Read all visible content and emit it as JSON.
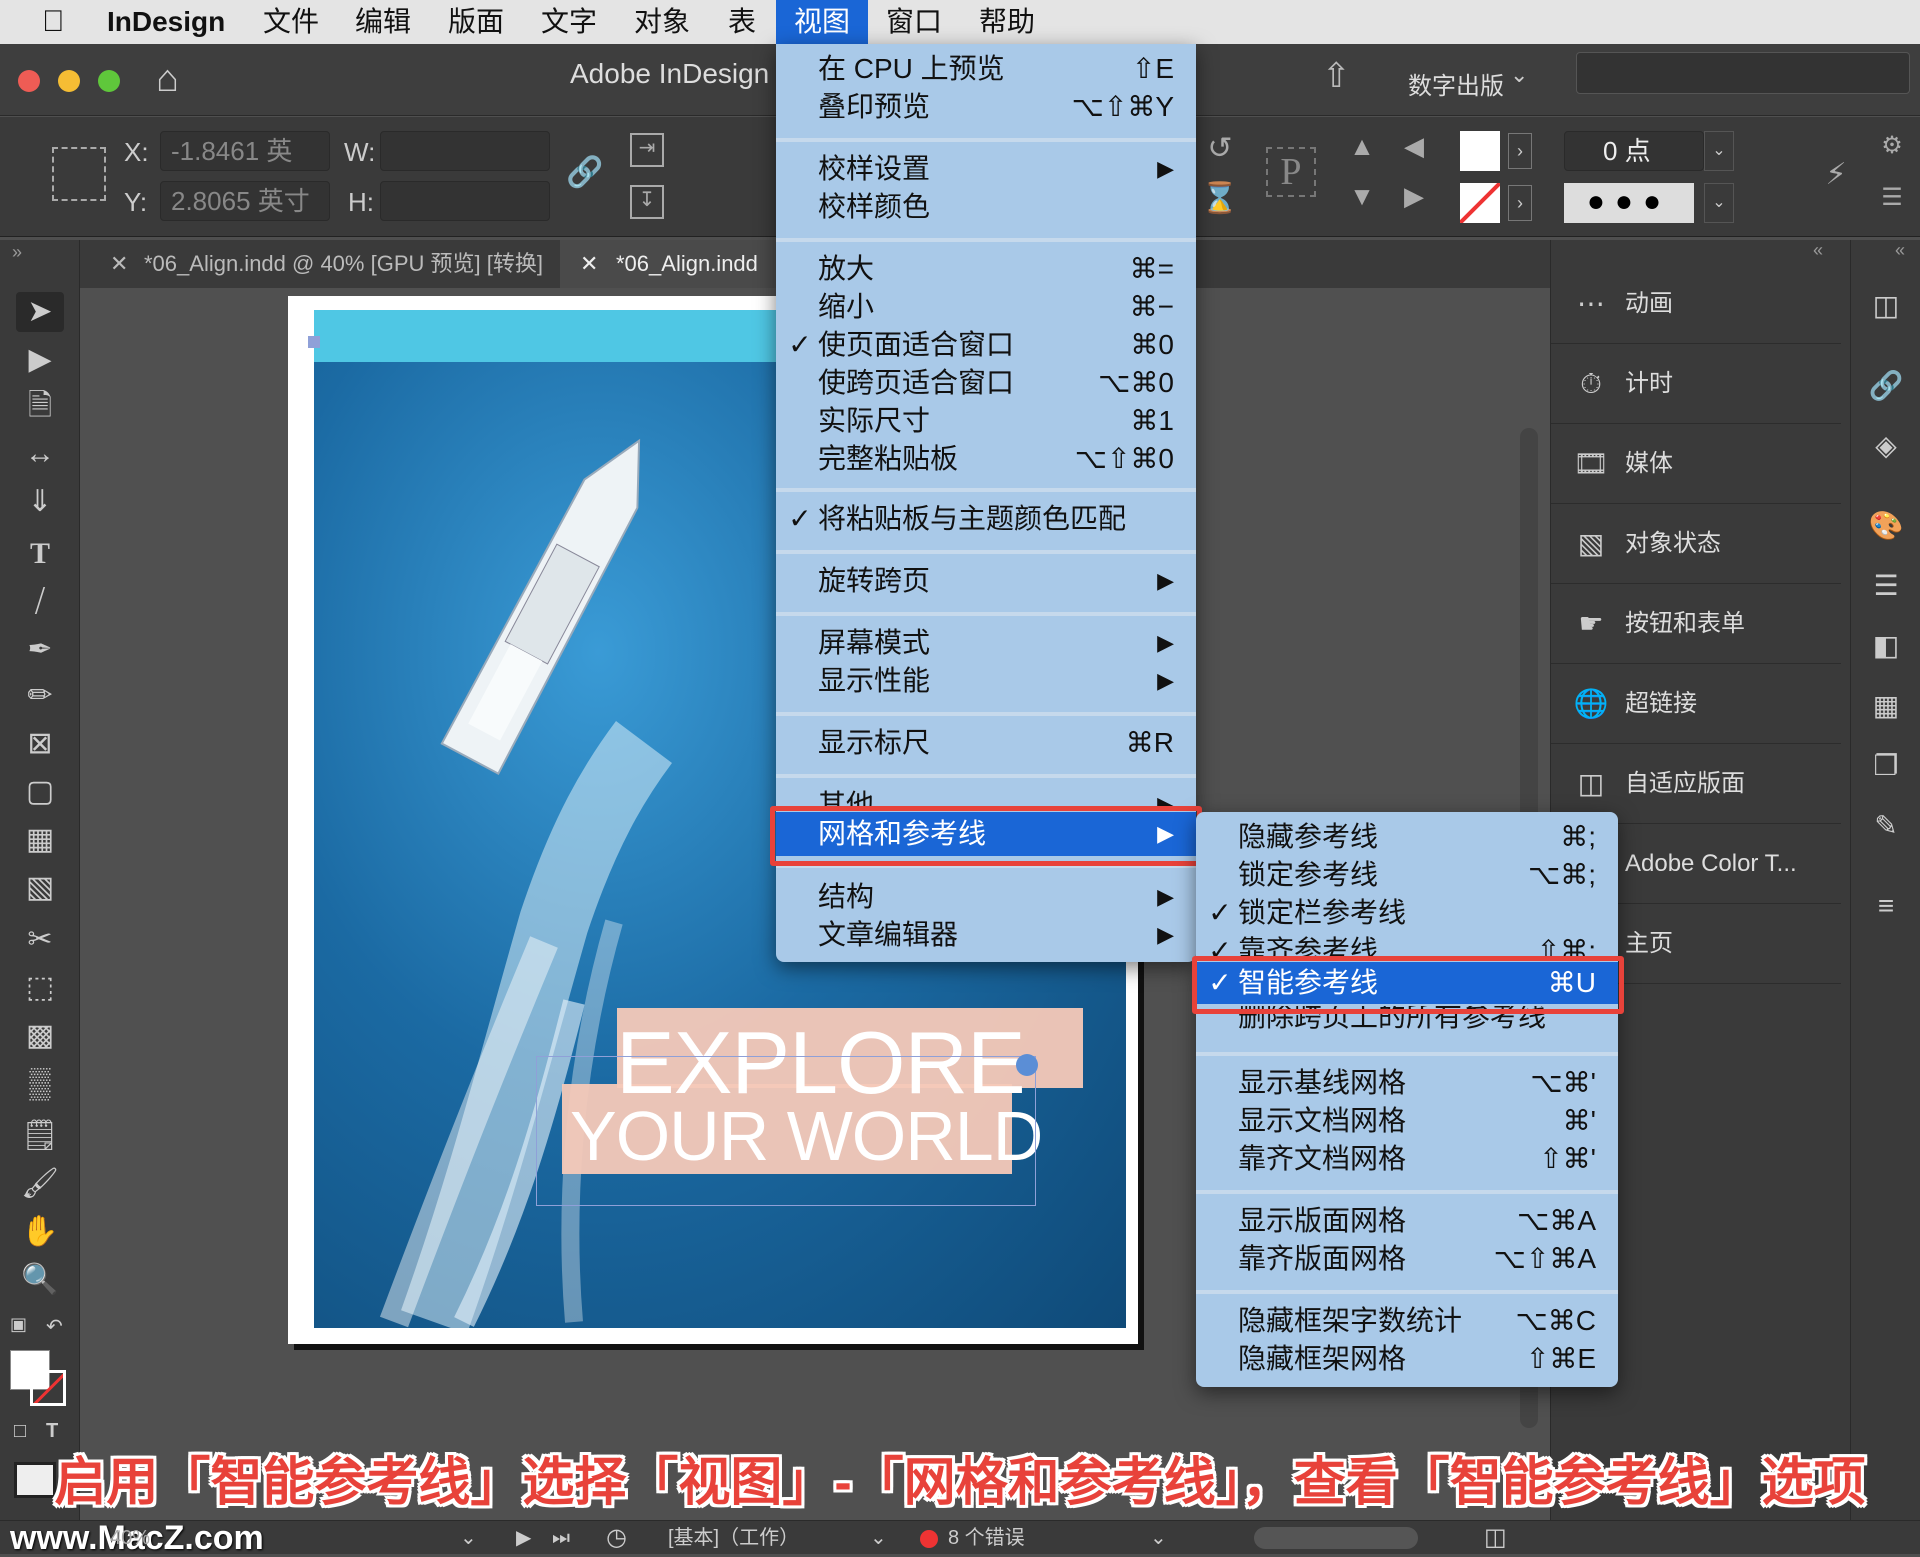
{
  "menubar": {
    "app_name": "InDesign",
    "items": [
      "文件",
      "编辑",
      "版面",
      "文字",
      "对象",
      "表",
      "视图",
      "窗口",
      "帮助"
    ],
    "active_item": "视图"
  },
  "window": {
    "title": "Adobe InDesign",
    "workspace": "数字出版"
  },
  "control_panel": {
    "x_label": "X:",
    "x_value": "-1.8461 英",
    "y_label": "Y:",
    "y_value": "2.8065 英寸",
    "w_label": "W:",
    "h_label": "H:",
    "stroke_weight": "0 点",
    "p_label": "P"
  },
  "tabs": [
    {
      "label": "*06_Align.indd @ 40% [GPU 预览] [转换]"
    },
    {
      "label": "*06_Align.indd"
    }
  ],
  "view_menu": {
    "items": [
      {
        "label": "在 CPU 上预览",
        "shortcut": "⇧E"
      },
      {
        "label": "叠印预览",
        "shortcut": "⌥⇧⌘Y"
      },
      {
        "label": "校样设置",
        "arrow": "▶"
      },
      {
        "label": "校样颜色"
      },
      {
        "label": "放大",
        "shortcut": "⌘="
      },
      {
        "label": "缩小",
        "shortcut": "⌘−"
      },
      {
        "label": "使页面适合窗口",
        "shortcut": "⌘0",
        "check": "✓"
      },
      {
        "label": "使跨页适合窗口",
        "shortcut": "⌥⌘0"
      },
      {
        "label": "实际尺寸",
        "shortcut": "⌘1"
      },
      {
        "label": "完整粘贴板",
        "shortcut": "⌥⇧⌘0"
      },
      {
        "label": "将粘贴板与主题颜色匹配",
        "check": "✓"
      },
      {
        "label": "旋转跨页",
        "arrow": "▶"
      },
      {
        "label": "屏幕模式",
        "arrow": "▶"
      },
      {
        "label": "显示性能",
        "arrow": "▶"
      },
      {
        "label": "显示标尺",
        "shortcut": "⌘R"
      },
      {
        "label": "其他",
        "arrow": "▶"
      },
      {
        "label": "网格和参考线",
        "arrow": "▶"
      },
      {
        "label": "结构",
        "arrow": "▶"
      },
      {
        "label": "文章编辑器",
        "arrow": "▶"
      }
    ]
  },
  "grids_submenu": {
    "items": [
      {
        "label": "隐藏参考线",
        "shortcut": "⌘;"
      },
      {
        "label": "锁定参考线",
        "shortcut": "⌥⌘;"
      },
      {
        "label": "锁定栏参考线",
        "check": "✓"
      },
      {
        "label": "靠齐参考线",
        "shortcut": "⇧⌘;",
        "check": "✓"
      },
      {
        "label": "智能参考线",
        "shortcut": "⌘U",
        "check": "✓"
      },
      {
        "label": "删除跨页上的所有参考线"
      },
      {
        "label": "显示基线网格",
        "shortcut": "⌥⌘'"
      },
      {
        "label": "显示文档网格",
        "shortcut": "⌘'"
      },
      {
        "label": "靠齐文档网格",
        "shortcut": "⇧⌘'"
      },
      {
        "label": "显示版面网格",
        "shortcut": "⌥⌘A"
      },
      {
        "label": "靠齐版面网格",
        "shortcut": "⌥⇧⌘A"
      },
      {
        "label": "隐藏框架字数统计",
        "shortcut": "⌥⌘C"
      },
      {
        "label": "隐藏框架网格",
        "shortcut": "⇧⌘E"
      }
    ]
  },
  "right_panel": {
    "items": [
      "动画",
      "计时",
      "媒体",
      "对象状态",
      "按钮和表单",
      "超链接",
      "自适应版面",
      "Adobe Color T...",
      "主页"
    ]
  },
  "document": {
    "headline_1": "EXPLORE",
    "headline_2": "YOUR WORLD"
  },
  "status_bar": {
    "zoom": "40%",
    "preflight_profile": "[基本]（工作）",
    "errors": "8 个错误",
    "watermark": "www.MacZ.com"
  },
  "caption": "启用「智能参考线」选择「视图」-「网格和参考线」，查看「智能参考线」选项",
  "colors": {
    "highlight": "#1a66d6",
    "menu_bg": "#a9c9e8",
    "annotation_red": "#e8423a",
    "headline_box": "#f6c9b8",
    "sea": "#1b6aa3"
  }
}
